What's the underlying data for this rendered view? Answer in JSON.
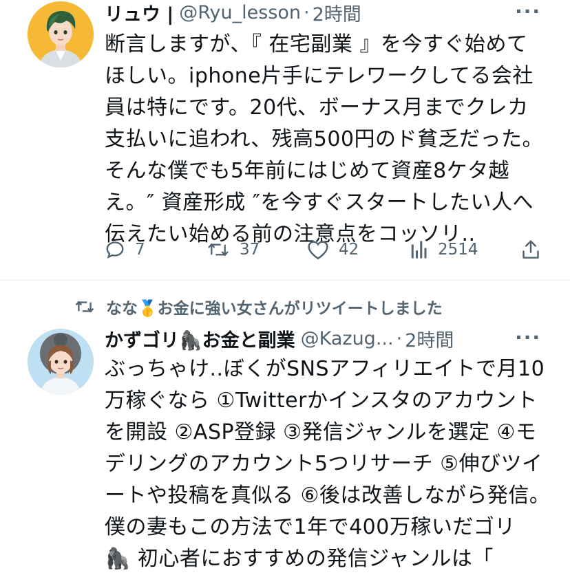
{
  "tweet1": {
    "name": "リュウ |",
    "handle": "@Ryu_lesson",
    "dot": "·",
    "time": "2時間",
    "more": "···",
    "lines": [
      "断言しますが、『 在宅副業 』を今すぐ始めて",
      "ほしい。iphone片手にテレワークしてる会社",
      "員は特にです。20代、ボーナス月までクレカ",
      "支払いに追われ、残高500円のド貧乏だった。",
      "そんな僕でも5年前にはじめて資産8ケタ越",
      "え。″ 資産形成 ″を今すぐスタートしたい人へ",
      "伝えたい始める前の注意点をコッソリ.."
    ],
    "actions": {
      "reply_icon": "reply-icon",
      "reply_count": "7",
      "retweet_icon": "retweet-icon",
      "retweet_count": "37",
      "like_icon": "heart-icon",
      "like_count": "42",
      "views_icon": "views-icon",
      "views_count": "2514",
      "share_icon": "share-icon"
    }
  },
  "tweet2": {
    "retweeted_by": "なな🥇お金に強い女さんがリツイートしました",
    "name": "かずゴリ🦍お金と副業",
    "handle": "@Kazug...",
    "dot": "·",
    "time": "2時間",
    "more": "···",
    "lines": [
      "ぶっちゃけ..ぼくがSNSアフィリエイトで月10",
      "万稼ぐなら ①Twitterかインスタのアカウント",
      "を開設 ②ASP登録 ③発信ジャンルを選定 ④モ",
      "デリングのアカウント5つリサーチ ⑤伸びツイ",
      "ートや投稿を真似る ⑥後は改善しながら発信。",
      "僕の妻もこの方法で1年で400万稼いだゴリ",
      "🦍 初心者におすすめの発信ジャンルは「"
    ]
  },
  "colors": {
    "text": "#0f1419",
    "secondary": "#536471",
    "divider": "#eff3f4"
  }
}
